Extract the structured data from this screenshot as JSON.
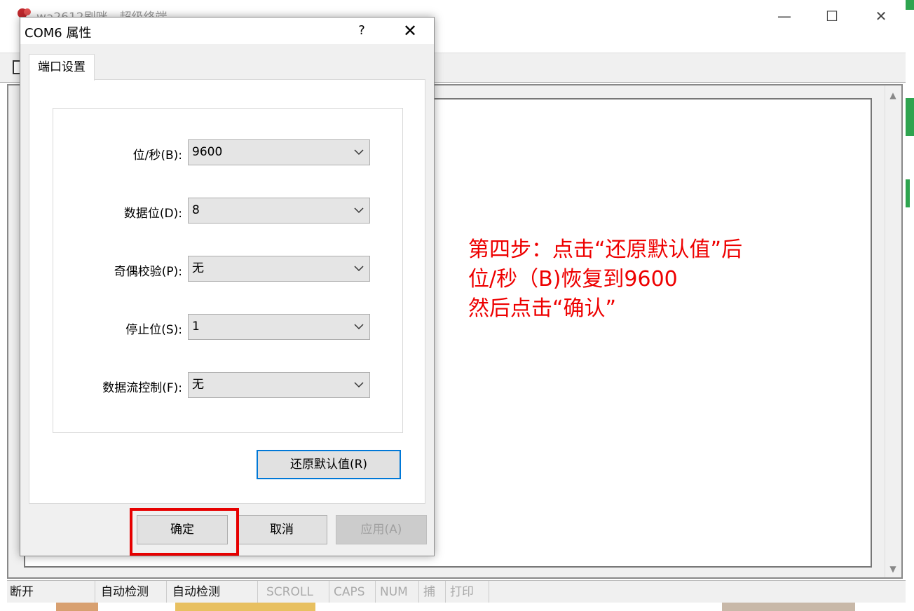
{
  "main_window": {
    "title": "wa2612刷咪 - 超级终端",
    "controls": {
      "minimize": "—",
      "maximize": "☐",
      "close": "✕"
    }
  },
  "annotation": {
    "lines": [
      "第四步：点击“还原默认值”后",
      "位/秒（B)恢复到9600",
      "然后点击“确认”"
    ],
    "color": "#ee0000"
  },
  "statusbar": {
    "cells": [
      "断开",
      "自动检测",
      "自动检测",
      "SCROLL",
      "CAPS",
      "NUM",
      "捕",
      "打印"
    ]
  },
  "dialog": {
    "title": "COM6 属性",
    "help": "?",
    "close": "✕",
    "tab": "端口设置",
    "fields": [
      {
        "label": "位/秒(B):",
        "value": "9600"
      },
      {
        "label": "数据位(D):",
        "value": "8"
      },
      {
        "label": "奇偶校验(P):",
        "value": "无"
      },
      {
        "label": "停止位(S):",
        "value": "1"
      },
      {
        "label": "数据流控制(F):",
        "value": "无"
      }
    ],
    "restore_button": "还原默认值(R)",
    "ok_button": "确定",
    "cancel_button": "取消",
    "apply_button": "应用(A)",
    "highlight_color": "#e60000"
  }
}
